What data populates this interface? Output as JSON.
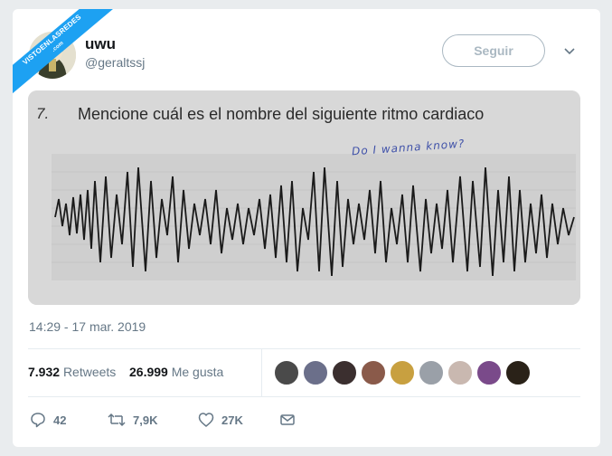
{
  "watermark": {
    "text": "VISTOENLASREDES",
    "sub": ".com"
  },
  "user": {
    "display_name": "uwu",
    "handle": "@geraltssj"
  },
  "follow_button": {
    "label": "Seguir"
  },
  "photo": {
    "question_number": "7.",
    "question_text": "Mencione cuál es el nombre del siguiente ritmo cardiaco",
    "handwritten_note": "Do I wanna know?"
  },
  "timestamp": "14:29 - 17 mar. 2019",
  "stats": {
    "retweets_count": "7.932",
    "retweets_label": "Retweets",
    "likes_count": "26.999",
    "likes_label": "Me gusta"
  },
  "liker_avatars": [
    {
      "name": "liker-avatar-1",
      "color": "#4a4a4a"
    },
    {
      "name": "liker-avatar-2",
      "color": "#6b6f8a"
    },
    {
      "name": "liker-avatar-3",
      "color": "#3b2f2f"
    },
    {
      "name": "liker-avatar-4",
      "color": "#8a5a4a"
    },
    {
      "name": "liker-avatar-5",
      "color": "#c8a040"
    },
    {
      "name": "liker-avatar-6",
      "color": "#9aa0a8"
    },
    {
      "name": "liker-avatar-7",
      "color": "#c9b8b0"
    },
    {
      "name": "liker-avatar-8",
      "color": "#7a4a8a"
    },
    {
      "name": "liker-avatar-9",
      "color": "#2a2218"
    }
  ],
  "actions": {
    "replies": "42",
    "retweets": "7,9K",
    "likes": "27K"
  },
  "colors": {
    "accent": "#1da1f2",
    "muted": "#657786",
    "border": "#e6ecf0"
  }
}
